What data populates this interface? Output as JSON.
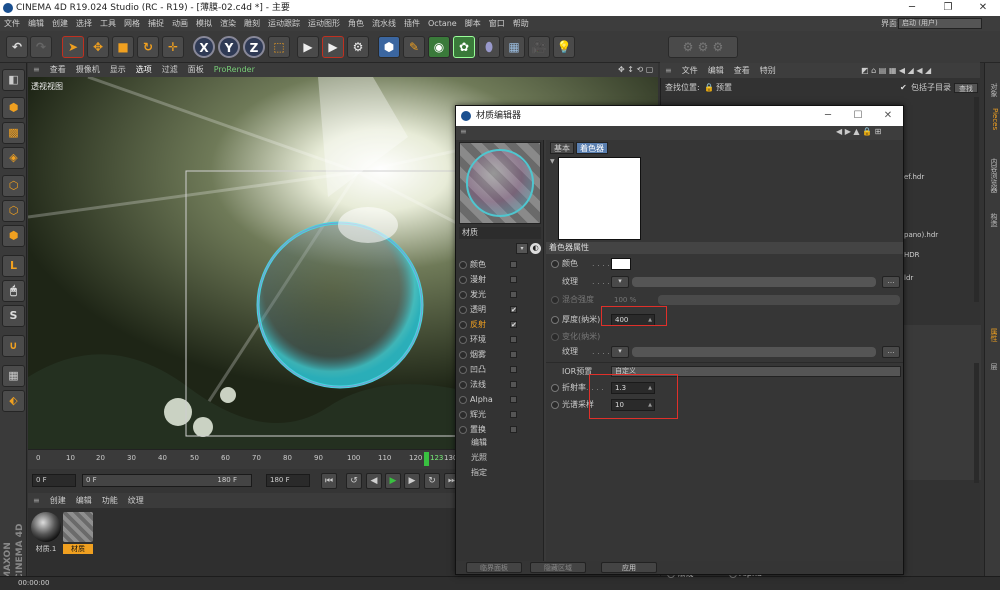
{
  "window": {
    "title": "CINEMA 4D R19.024 Studio (RC - R19) - [薄膜-02.c4d *] - 主要",
    "buttons": [
      "─",
      "❐",
      "✕"
    ]
  },
  "menubar": {
    "items": [
      "文件",
      "编辑",
      "创建",
      "选择",
      "工具",
      "网格",
      "捕捉",
      "动画",
      "模拟",
      "渲染",
      "雕刻",
      "运动跟踪",
      "运动图形",
      "角色",
      "流水线",
      "插件",
      "Octane",
      "脚本",
      "窗口",
      "帮助"
    ],
    "layout_label": "界面:",
    "layout_value": "启动 (用户)"
  },
  "toolbar": {
    "undo_icon": "undo-icon",
    "axes": [
      "X",
      "Y",
      "Z"
    ]
  },
  "viewport": {
    "menu": [
      "查看",
      "摄像机",
      "显示",
      "选项",
      "过滤",
      "面板",
      "ProRender"
    ],
    "label": "透视视图",
    "accent": "#f0a020"
  },
  "timeline": {
    "ticks": [
      "0",
      "10",
      "20",
      "30",
      "40",
      "50",
      "60",
      "70",
      "80",
      "90",
      "100",
      "110",
      "120"
    ],
    "current_frame": "123",
    "end_tick": "130",
    "playhead_color": "#39c040"
  },
  "playback": {
    "start_field": "0 F",
    "current_field": "0 F",
    "slider_end": "180 F",
    "end_field": "180 F"
  },
  "material_manager": {
    "menu": [
      "创建",
      "编辑",
      "功能",
      "纹理"
    ],
    "materials": [
      "材质.1",
      "材质"
    ]
  },
  "statusbar": {
    "time": "00:00:00"
  },
  "brand": "MAXON CINEMA 4D",
  "right_panel": {
    "menu": [
      "文件",
      "编辑",
      "查看",
      "特别"
    ],
    "find_label": "查找位置:",
    "preset_label": "预置",
    "include_sub": "包括子目录",
    "search_btn": "查找",
    "files": [
      "ef.hdr",
      "pano).hdr",
      "HDR",
      "ldr"
    ],
    "bottom_channels": [
      "法线",
      "Alpha"
    ],
    "tabs": [
      "对象",
      "Pieces",
      "内容浏览器",
      "构造",
      "属性",
      "层"
    ]
  },
  "material_editor": {
    "title": "材质编辑器",
    "material_name": "材质",
    "tabs": [
      "基本",
      "着色器"
    ],
    "section_title": "着色器属性",
    "channels": [
      {
        "label": "颜色",
        "checked": ""
      },
      {
        "label": "漫射",
        "checked": ""
      },
      {
        "label": "发光",
        "checked": ""
      },
      {
        "label": "透明",
        "checked": "✔"
      },
      {
        "label": "反射",
        "checked": "✔"
      },
      {
        "label": "环境",
        "checked": ""
      },
      {
        "label": "烟雾",
        "checked": ""
      },
      {
        "label": "凹凸",
        "checked": ""
      },
      {
        "label": "法线",
        "checked": ""
      },
      {
        "label": "Alpha",
        "checked": ""
      },
      {
        "label": "辉光",
        "checked": ""
      },
      {
        "label": "置换",
        "checked": ""
      }
    ],
    "subitems": [
      "编辑",
      "光照",
      "指定"
    ],
    "props": {
      "color_label": "颜色",
      "texture_label": "纹理",
      "mix_label": "混合强度",
      "mix_value": "100 %",
      "thickness_label": "厚度(纳米)",
      "thickness_value": "400",
      "variation_label": "变化(纳米)",
      "texture2_label": "纹理",
      "ior_preset_label": "IOR预置",
      "ior_preset_value": "自定义",
      "ior_label": "折射率",
      "ior_value": "1.3",
      "samples_label": "光谱采样",
      "samples_value": "10"
    },
    "footer": [
      "临界面板",
      "隐藏区域",
      "应用"
    ],
    "highlight_color": "#e0302a"
  }
}
